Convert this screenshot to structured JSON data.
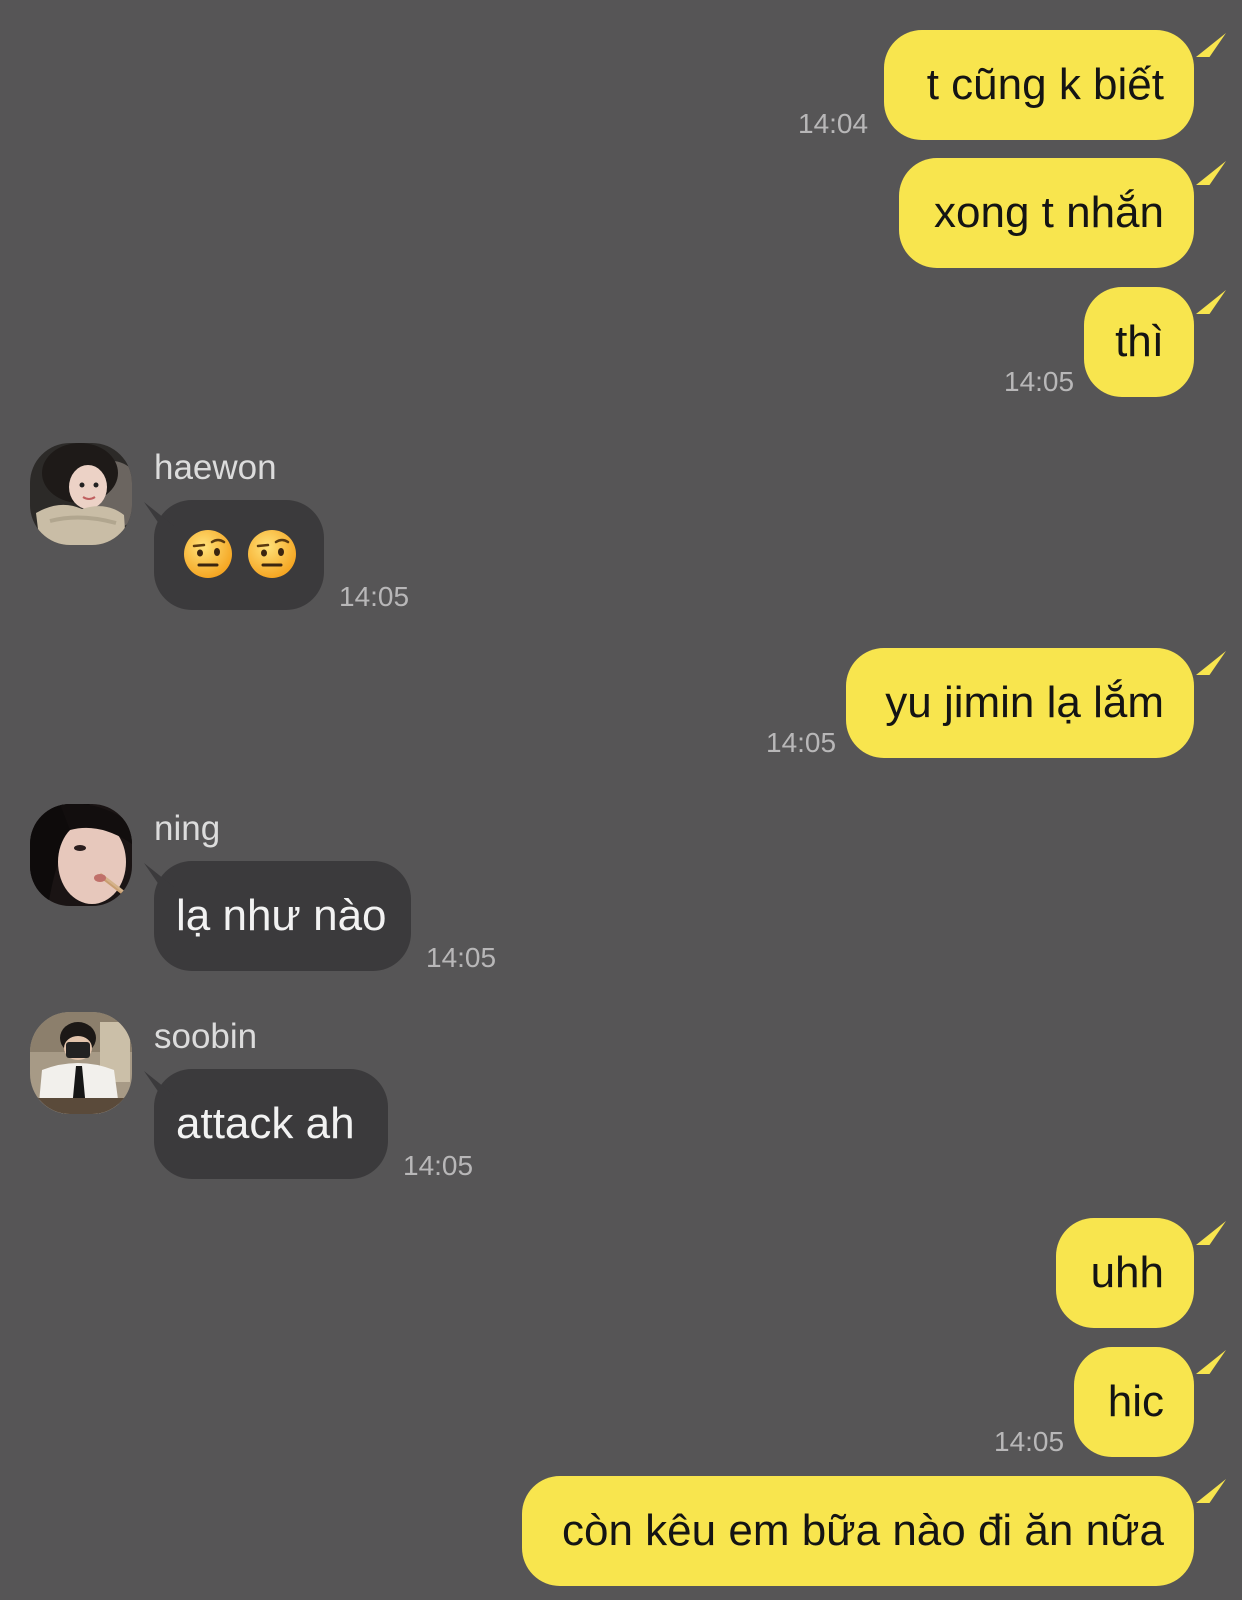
{
  "messages": [
    {
      "id": "m1",
      "side": "mine",
      "text": "t cũng k biết",
      "time": "14:04"
    },
    {
      "id": "m2",
      "side": "mine",
      "text": "xong t nhắn",
      "time": ""
    },
    {
      "id": "m3",
      "side": "mine",
      "text": "thì",
      "time": "14:05"
    },
    {
      "id": "m4",
      "side": "theirs",
      "sender": "haewon",
      "avatar": "avatar-haewon",
      "emoji": [
        "face-with-raised-eyebrow",
        "face-with-raised-eyebrow"
      ],
      "time": "14:05"
    },
    {
      "id": "m5",
      "side": "mine",
      "text": "yu jimin lạ lắm",
      "time": "14:05"
    },
    {
      "id": "m6",
      "side": "theirs",
      "sender": "ning",
      "avatar": "avatar-ning",
      "text": "lạ như nào",
      "time": "14:05"
    },
    {
      "id": "m7",
      "side": "theirs",
      "sender": "soobin",
      "avatar": "avatar-soobin",
      "text": "attack ah",
      "time": "14:05"
    },
    {
      "id": "m8",
      "side": "mine",
      "text": "uhh",
      "time": ""
    },
    {
      "id": "m9",
      "side": "mine",
      "text": "hic",
      "time": "14:05"
    },
    {
      "id": "m10",
      "side": "mine",
      "text": "còn kêu em bữa nào đi ăn nữa",
      "time": ""
    }
  ],
  "colors": {
    "background": "#565556",
    "my_bubble": "#f8e54e",
    "their_bubble": "#3b3a3c",
    "timestamp": "#b8b7b8",
    "sender_name": "#dcdcdc"
  }
}
